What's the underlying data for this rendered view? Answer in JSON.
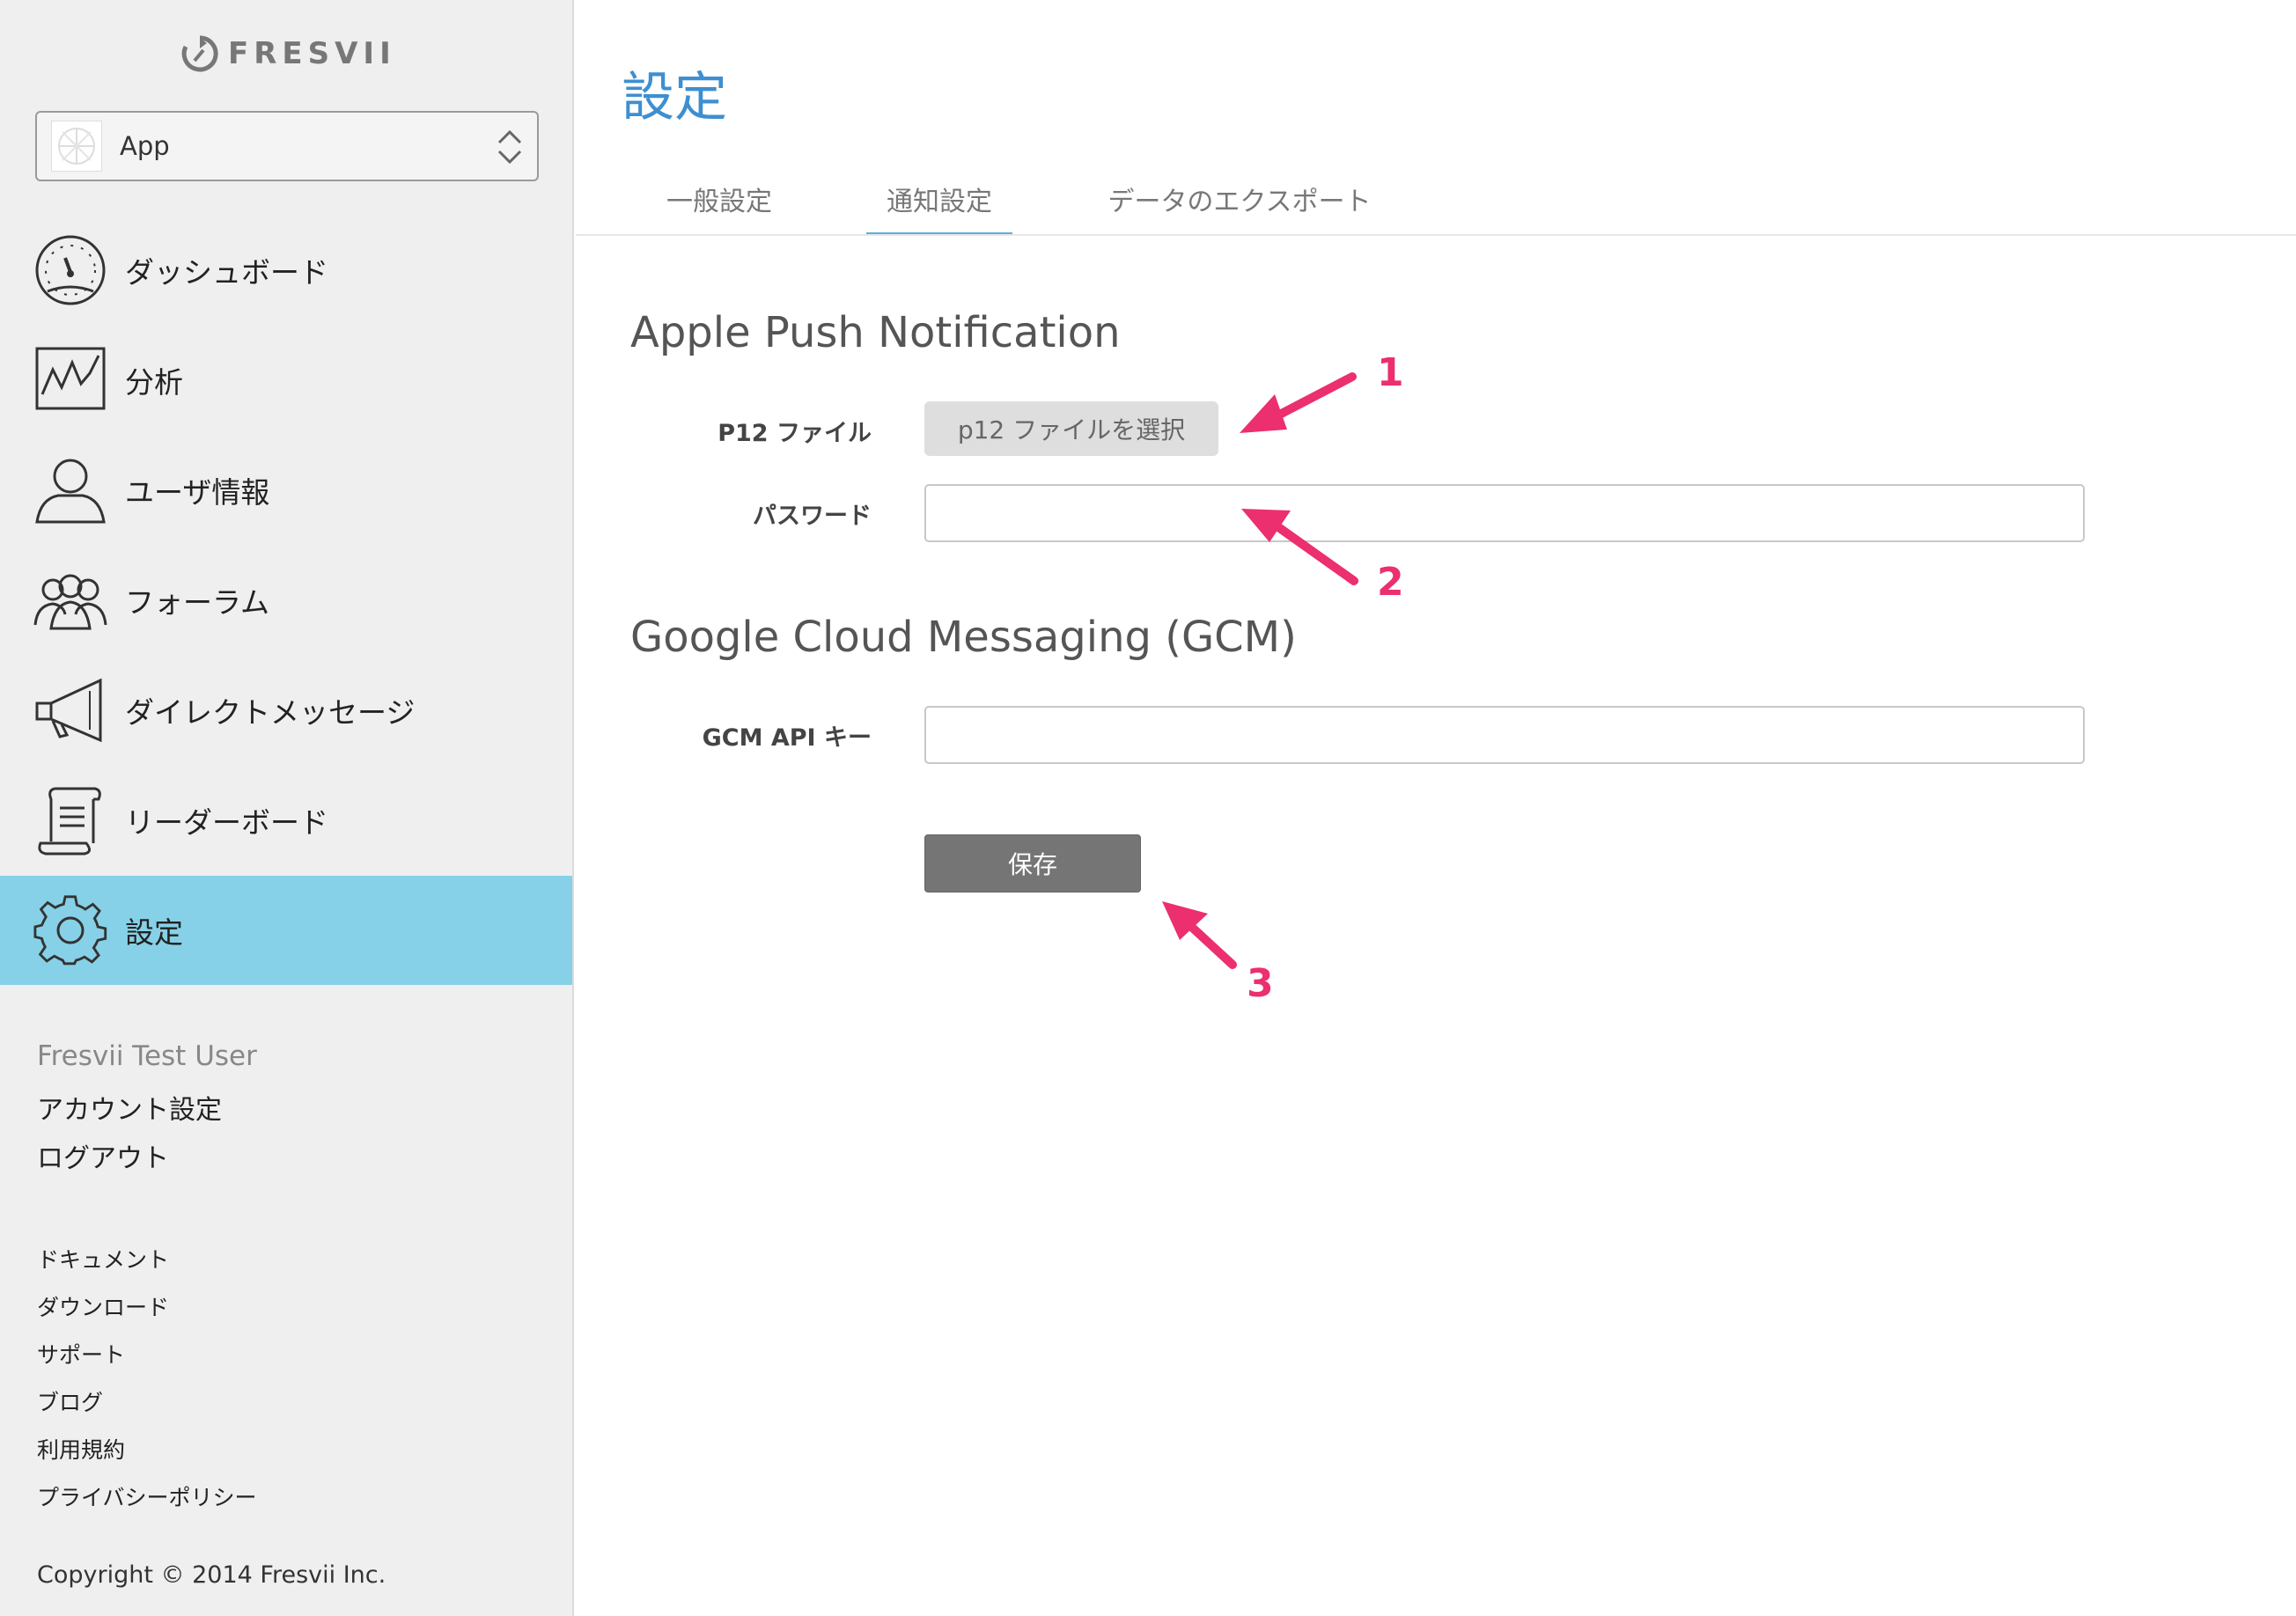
{
  "brand": {
    "logo_text": "FRESVII"
  },
  "app_selector": {
    "value": "App"
  },
  "nav": {
    "items": [
      {
        "label": "ダッシュボード",
        "icon": "dashboard-gauge-icon"
      },
      {
        "label": "分析",
        "icon": "analytics-chart-icon"
      },
      {
        "label": "ユーザ情報",
        "icon": "user-icon"
      },
      {
        "label": "フォーラム",
        "icon": "forum-users-icon"
      },
      {
        "label": "ダイレクトメッセージ",
        "icon": "megaphone-icon"
      },
      {
        "label": "リーダーボード",
        "icon": "scroll-icon"
      },
      {
        "label": "設定",
        "icon": "gear-icon",
        "active": true
      }
    ]
  },
  "account": {
    "user_name": "Fresvii Test User",
    "account_settings": "アカウント設定",
    "logout": "ログアウト"
  },
  "footer_links": [
    "ドキュメント",
    "ダウンロード",
    "サポート",
    "ブログ",
    "利用規約",
    "プライバシーポリシー"
  ],
  "copyright": "Copyright © 2014 Fresvii Inc.",
  "page": {
    "title": "設定",
    "tabs": [
      {
        "label": "一般設定"
      },
      {
        "label": "通知設定",
        "active": true
      },
      {
        "label": "データのエクスポート"
      }
    ]
  },
  "apple_push": {
    "section_title": "Apple Push Notification",
    "p12_label": "P12 ファイル",
    "p12_button": "p12 ファイルを選択",
    "password_label": "パスワード",
    "password_value": ""
  },
  "gcm": {
    "section_title": "Google Cloud Messaging (GCM)",
    "api_key_label": "GCM API キー",
    "api_key_value": ""
  },
  "save_button": "保存",
  "annotations": [
    "1",
    "2",
    "3"
  ],
  "colors": {
    "accent_title": "#3d8fd1",
    "active_nav": "#86d1e7",
    "annotation_arrow": "#ec2f6e",
    "save_button": "#757575"
  }
}
